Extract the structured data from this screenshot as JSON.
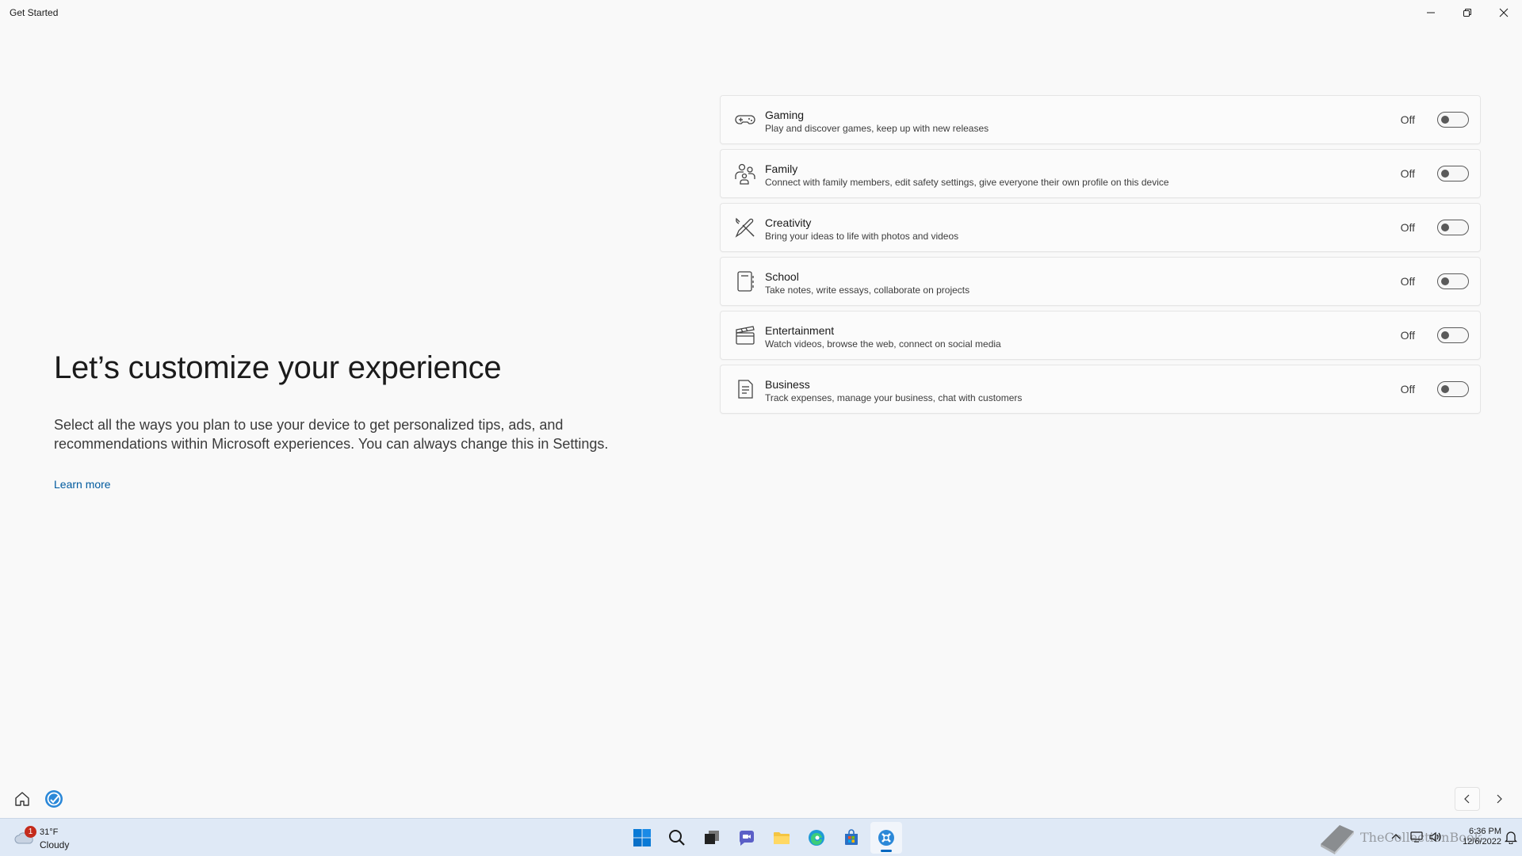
{
  "window": {
    "title": "Get Started",
    "controls": [
      "minimize-icon",
      "restore-icon",
      "close-icon"
    ]
  },
  "hero": {
    "title": "Let’s customize your experience",
    "description": "Select all the ways you plan to use your device to get personalized tips, ads, and recommendations within Microsoft experiences. You can always change this in Settings.",
    "learn_more": "Learn more"
  },
  "categories": [
    {
      "icon": "gamepad-icon",
      "title": "Gaming",
      "description": "Play and discover games, keep up with new releases",
      "state": "Off",
      "enabled": false
    },
    {
      "icon": "family-icon",
      "title": "Family",
      "description": "Connect with family members, edit safety settings, give everyone their own profile on this device",
      "state": "Off",
      "enabled": false
    },
    {
      "icon": "pencil-brush-icon",
      "title": "Creativity",
      "description": "Bring your ideas to life with photos and videos",
      "state": "Off",
      "enabled": false
    },
    {
      "icon": "notebook-icon",
      "title": "School",
      "description": "Take notes, write essays, collaborate on projects",
      "state": "Off",
      "enabled": false
    },
    {
      "icon": "clapperboard-icon",
      "title": "Entertainment",
      "description": "Watch videos, browse the web, connect on social media",
      "state": "Off",
      "enabled": false
    },
    {
      "icon": "document-icon",
      "title": "Business",
      "description": "Track expenses, manage your business, chat with customers",
      "state": "Off",
      "enabled": false
    }
  ],
  "app_nav": {
    "home_icon": "home-icon",
    "tips_icon": "tips-icon",
    "prev_icon": "chevron-left-icon",
    "next_icon": "chevron-right-icon"
  },
  "taskbar": {
    "weather": {
      "badge": "1",
      "temp": "31°F",
      "condition": "Cloudy"
    },
    "apps": [
      {
        "icon": "windows-start-icon",
        "active": false
      },
      {
        "icon": "search-icon",
        "active": false
      },
      {
        "icon": "task-view-icon",
        "active": false
      },
      {
        "icon": "teams-chat-icon",
        "active": false
      },
      {
        "icon": "file-explorer-icon",
        "active": false
      },
      {
        "icon": "edge-icon",
        "active": false
      },
      {
        "icon": "store-icon",
        "active": false
      },
      {
        "icon": "get-started-icon",
        "active": true
      }
    ],
    "watermark_text": "TheCollectionBook",
    "time": "6:36 PM",
    "date": "12/6/2022",
    "colors": {
      "accent": "#0067c0",
      "taskbar": "#dfe9f6"
    }
  }
}
